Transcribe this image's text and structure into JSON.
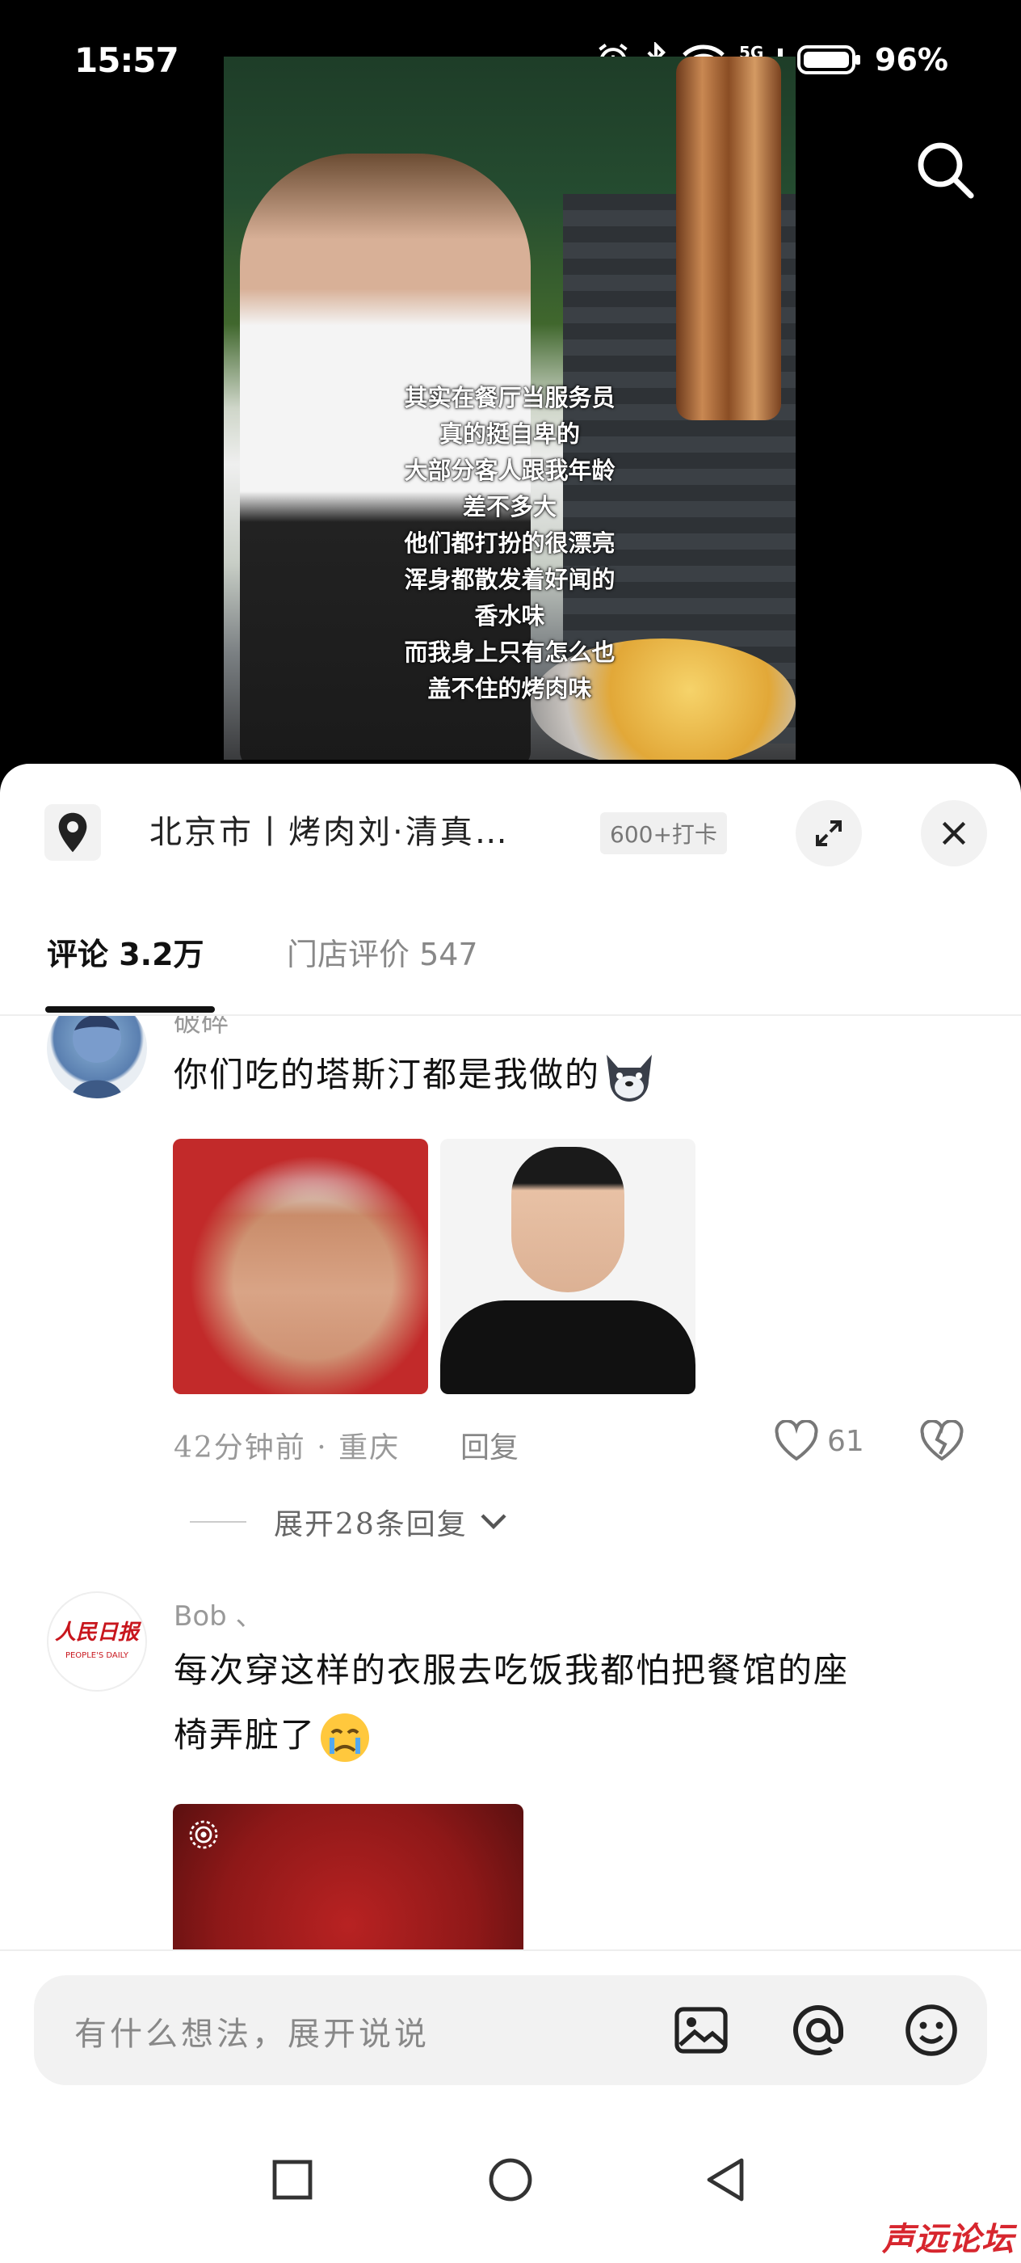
{
  "status_bar": {
    "time": "15:57",
    "battery": "96%"
  },
  "video": {
    "subtitle_lines": [
      "其实在餐厅当服务员",
      "真的挺自卑的",
      "大部分客人跟我年龄",
      "差不多大",
      "他们都打扮的很漂亮",
      "浑身都散发着好闻的",
      "香水味",
      "而我身上只有怎么也",
      "盖不住的烤肉味"
    ]
  },
  "location": {
    "text": "北京市丨烤肉刘·清真…",
    "checkin": "600+打卡"
  },
  "tabs": {
    "comments": "评论 3.2万",
    "store_reviews": "门店评价 547"
  },
  "comments": [
    {
      "username": "破碎",
      "text": "你们吃的塔斯汀都是我做的",
      "emoji_icon": "wolf-face-icon",
      "time_location": "42分钟前 · 重庆",
      "reply_label": "回复",
      "likes": "61",
      "expand_replies": "展开28条回复"
    },
    {
      "username": "Bob 、",
      "avatar_text": "人民日报",
      "avatar_subtext": "PEOPLE'S DAILY",
      "text_line1": "每次穿这样的衣服去吃饭我都怕把餐馆的座",
      "text_line2": "椅弄脏了",
      "emoji_icon": "crying-face-icon"
    }
  ],
  "input": {
    "placeholder": "有什么想法，展开说说"
  },
  "watermark": "声远论坛",
  "colors": {
    "accent_red": "#d7262e",
    "sheet_bg": "#ffffff",
    "pill_bg": "#f2f2f2"
  }
}
